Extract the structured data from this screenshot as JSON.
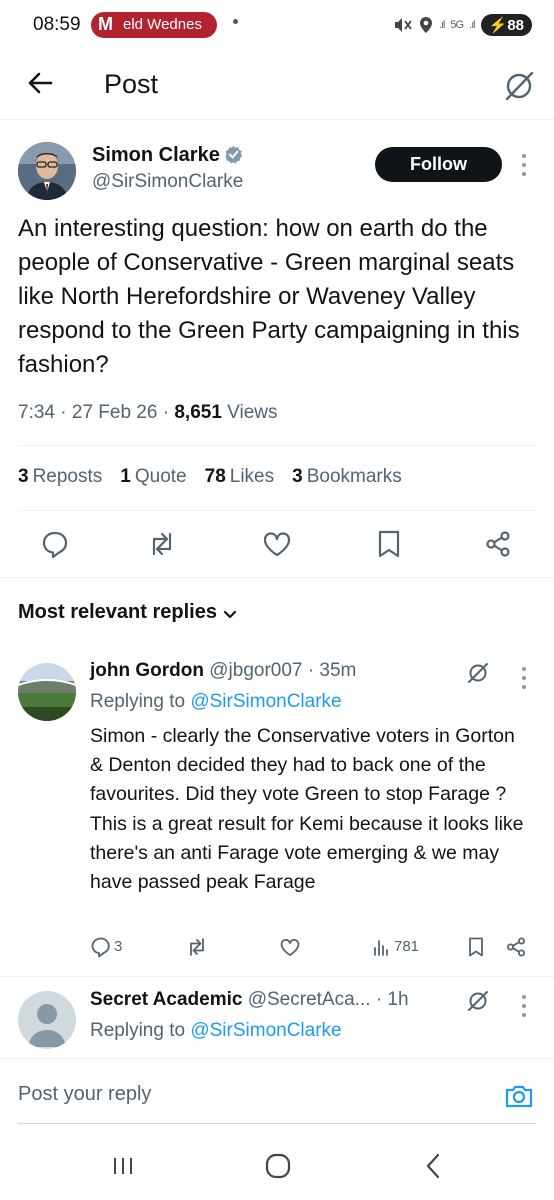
{
  "status_bar": {
    "time": "08:59",
    "notification_letter": "M",
    "notification_text": "eld Wednes",
    "network": "5G",
    "battery": "88"
  },
  "header": {
    "title": "Post"
  },
  "post": {
    "author_name": "Simon Clarke",
    "author_handle": "@SirSimonClarke",
    "follow_label": "Follow",
    "text": "An interesting question: how on earth do the people of Conservative - Green marginal seats like North Herefordshire or Waveney Valley respond to the Green Party campaigning in this fashion?",
    "time": "7:34",
    "date": "27 Feb 26",
    "views_count": "8,651",
    "views_label": "Views",
    "stats": {
      "reposts_count": "3",
      "reposts_label": "Reposts",
      "quotes_count": "1",
      "quotes_label": "Quote",
      "likes_count": "78",
      "likes_label": "Likes",
      "bookmarks_count": "3",
      "bookmarks_label": "Bookmarks"
    }
  },
  "replies_filter": {
    "label": "Most relevant replies"
  },
  "replies": [
    {
      "name": "john Gordon",
      "handle": "@jbgor007",
      "time": "35m",
      "replying_prefix": "Replying to",
      "replying_to": "@SirSimonClarke",
      "text": "Simon - clearly the Conservative voters in Gorton & Denton decided they had to back one of the favourites. Did they vote Green to stop Farage ? This is a great result for Kemi because it looks like there's an anti Farage vote emerging & we may have passed peak Farage",
      "reply_count": "3",
      "view_count": "781"
    },
    {
      "name": "Secret Academic",
      "handle": "@SecretAca...",
      "time": "1h",
      "replying_prefix": "Replying to",
      "replying_to": "@SirSimonClarke"
    }
  ],
  "composer": {
    "placeholder": "Post your reply"
  },
  "colors": {
    "accent": "#1d9bf0",
    "text": "#0f1419",
    "secondary": "#536471",
    "notification": "#b3222f"
  }
}
